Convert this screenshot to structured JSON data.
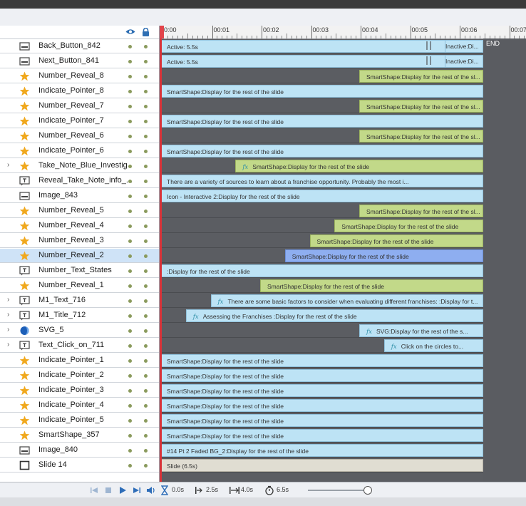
{
  "ruler": {
    "labels": [
      "0:00",
      "00:01",
      "00:02",
      "00:03",
      "00:04",
      "00:05",
      "00:06",
      "00:07"
    ],
    "end_label": "END"
  },
  "layers": [
    {
      "name": "Back_Button_842",
      "icon": "button-icon",
      "expand": false
    },
    {
      "name": "Next_Button_841",
      "icon": "button-icon",
      "expand": false
    },
    {
      "name": "Number_Reveal_8",
      "icon": "star-icon",
      "expand": false
    },
    {
      "name": "Indicate_Pointer_8",
      "icon": "star-icon",
      "expand": false
    },
    {
      "name": "Number_Reveal_7",
      "icon": "star-icon",
      "expand": false
    },
    {
      "name": "Indicate_Pointer_7",
      "icon": "star-icon",
      "expand": false
    },
    {
      "name": "Number_Reveal_6",
      "icon": "star-icon",
      "expand": false
    },
    {
      "name": "Indicate_Pointer_6",
      "icon": "star-icon",
      "expand": false
    },
    {
      "name": "Take_Note_Blue_Investig",
      "icon": "star-icon",
      "expand": true
    },
    {
      "name": "Reveal_Take_Note_info_...",
      "icon": "text-icon",
      "expand": false
    },
    {
      "name": "Image_843",
      "icon": "button-icon",
      "expand": false
    },
    {
      "name": "Number_Reveal_5",
      "icon": "star-icon",
      "expand": false
    },
    {
      "name": "Number_Reveal_4",
      "icon": "star-icon",
      "expand": false
    },
    {
      "name": "Number_Reveal_3",
      "icon": "star-icon",
      "expand": false
    },
    {
      "name": "Number_Reveal_2",
      "icon": "star-icon",
      "expand": false,
      "selected": true
    },
    {
      "name": "Number_Text_States",
      "icon": "text-icon",
      "expand": false
    },
    {
      "name": "Number_Reveal_1",
      "icon": "star-icon",
      "expand": false
    },
    {
      "name": "M1_Text_716",
      "icon": "text-icon",
      "expand": true
    },
    {
      "name": "M1_Title_712",
      "icon": "text-icon",
      "expand": true
    },
    {
      "name": "SVG_5",
      "icon": "svg-icon",
      "expand": true
    },
    {
      "name": "Text_Click_on_711",
      "icon": "text-icon",
      "expand": true
    },
    {
      "name": "Indicate_Pointer_1",
      "icon": "star-icon",
      "expand": false
    },
    {
      "name": "Indicate_Pointer_2",
      "icon": "star-icon",
      "expand": false
    },
    {
      "name": "Indicate_Pointer_3",
      "icon": "star-icon",
      "expand": false
    },
    {
      "name": "Indicate_Pointer_4",
      "icon": "star-icon",
      "expand": false
    },
    {
      "name": "Indicate_Pointer_5",
      "icon": "star-icon",
      "expand": false
    },
    {
      "name": "SmartShape_357",
      "icon": "star-icon",
      "expand": false
    },
    {
      "name": "Image_840",
      "icon": "button-icon",
      "expand": false
    },
    {
      "name": "Slide 14",
      "icon": "slide-icon",
      "expand": false
    }
  ],
  "bars": [
    {
      "text": "Active: 5.5s",
      "style": "blue",
      "start": 0,
      "fx": false,
      "inactive": "Inactive:Di..."
    },
    {
      "text": "Active: 5.5s",
      "style": "blue",
      "start": 0,
      "fx": false,
      "inactive": "Inactive:Di..."
    },
    {
      "text": "SmartShape:Display for the rest of the sl...",
      "style": "green",
      "start": 4.0,
      "fx": false
    },
    {
      "text": "SmartShape:Display for the rest of the slide",
      "style": "blue",
      "start": 0,
      "fx": false
    },
    {
      "text": "SmartShape:Display for the rest of the sl...",
      "style": "green",
      "start": 4.0,
      "fx": false
    },
    {
      "text": "SmartShape:Display for the rest of the slide",
      "style": "blue",
      "start": 0,
      "fx": false
    },
    {
      "text": "SmartShape:Display for the rest of the sl...",
      "style": "green",
      "start": 4.0,
      "fx": false
    },
    {
      "text": "SmartShape:Display for the rest of the slide",
      "style": "blue",
      "start": 0,
      "fx": false
    },
    {
      "text": "SmartShape:Display for the rest of the slide",
      "style": "green",
      "start": 1.5,
      "fx": true
    },
    {
      "text": "There are a variety of sources to      learn about a franchise      opportunity. Probably the most      i...",
      "style": "blue",
      "start": 0,
      "fx": false
    },
    {
      "text": "Icon - Interactive 2:Display for the rest of the slide",
      "style": "blue",
      "start": 0,
      "fx": false
    },
    {
      "text": "SmartShape:Display for the rest of the sl...",
      "style": "green",
      "start": 4.0,
      "fx": false
    },
    {
      "text": "SmartShape:Display for the rest of the slide",
      "style": "green",
      "start": 3.5,
      "fx": false
    },
    {
      "text": "SmartShape:Display for the rest of the slide",
      "style": "green",
      "start": 3.0,
      "fx": false
    },
    {
      "text": "SmartShape:Display for the rest of the slide",
      "style": "sel",
      "start": 2.5,
      "fx": false
    },
    {
      "text": ":Display for the rest of the slide",
      "style": "blue",
      "start": 0,
      "fx": false
    },
    {
      "text": "SmartShape:Display for the rest of the slide",
      "style": "green",
      "start": 2.0,
      "fx": false
    },
    {
      "text": "There are some basic factors to  consider when evaluating different franchises: :Display for t...",
      "style": "blue",
      "start": 1.0,
      "fx": true
    },
    {
      "text": "Assessing the Franchises  :Display for the rest of the slide",
      "style": "blue",
      "start": 0.5,
      "fx": true
    },
    {
      "text": "SVG:Display for the rest of the s...",
      "style": "blue",
      "start": 4.0,
      "fx": true
    },
    {
      "text": "Click on the circles to...",
      "style": "blue",
      "start": 4.5,
      "fx": true
    },
    {
      "text": "SmartShape:Display for the rest of the slide",
      "style": "blue",
      "start": 0,
      "fx": false
    },
    {
      "text": "SmartShape:Display for the rest of the slide",
      "style": "blue",
      "start": 0,
      "fx": false
    },
    {
      "text": "SmartShape:Display for the rest of the slide",
      "style": "blue",
      "start": 0,
      "fx": false
    },
    {
      "text": "SmartShape:Display for the rest of the slide",
      "style": "blue",
      "start": 0,
      "fx": false
    },
    {
      "text": "SmartShape:Display for the rest of the slide",
      "style": "blue",
      "start": 0,
      "fx": false
    },
    {
      "text": "SmartShape:Display for the rest of the slide",
      "style": "blue",
      "start": 0,
      "fx": false
    },
    {
      "text": "#14 Pt 2 Faded BG_2:Display for the rest of the slide",
      "style": "blue",
      "start": 0,
      "fx": false
    },
    {
      "text": "Slide (6.5s)",
      "style": "slide",
      "start": 0,
      "fx": false
    }
  ],
  "bottom": {
    "current_time": "0.0s",
    "start_time": "2.5s",
    "duration": "4.0s",
    "total": "6.5s"
  },
  "colors": {
    "blue_bar": "#bde3f5",
    "green_bar": "#c2d989",
    "selected_bar": "#8eaef0",
    "playhead": "#d8343a"
  }
}
